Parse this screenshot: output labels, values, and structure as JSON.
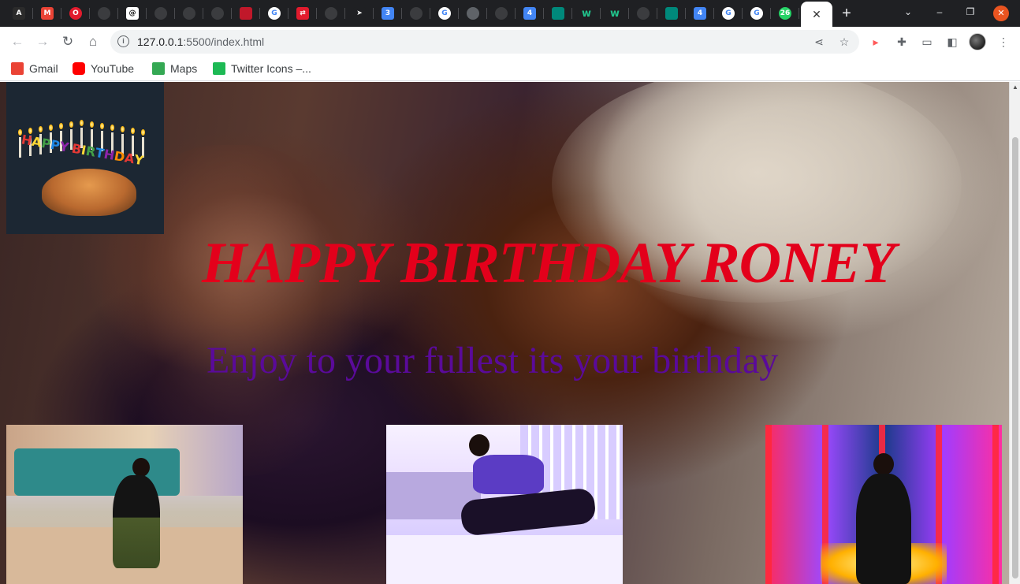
{
  "browser": {
    "tabs": [
      {
        "icon": "angular-icon",
        "color": "#2b2b2b",
        "glyph": "A"
      },
      {
        "icon": "gmail-icon",
        "color": "#ea4335",
        "glyph": "M"
      },
      {
        "icon": "opera-icon",
        "color": "#e21b2d",
        "glyph": "O"
      },
      {
        "icon": "github-icon",
        "color": "#3b3c3f",
        "glyph": ""
      },
      {
        "icon": "chatgpt-icon",
        "color": "#ffffff",
        "glyph": "@"
      },
      {
        "icon": "github-icon",
        "color": "#3b3c3f",
        "glyph": ""
      },
      {
        "icon": "github-icon",
        "color": "#3b3c3f",
        "glyph": ""
      },
      {
        "icon": "github-icon",
        "color": "#3b3c3f",
        "glyph": ""
      },
      {
        "icon": "ruby-icon",
        "color": "#c0182a",
        "glyph": ""
      },
      {
        "icon": "google-icon",
        "color": "#ffffff",
        "glyph": "G"
      },
      {
        "icon": "red-app-icon",
        "color": "#e21b2d",
        "glyph": "⇄"
      },
      {
        "icon": "globe-icon",
        "color": "#3b3c3f",
        "glyph": ""
      },
      {
        "icon": "arrow-icon",
        "color": "#1f2023",
        "glyph": "➤"
      },
      {
        "icon": "calendar-icon",
        "color": "#4285f4",
        "glyph": "3"
      },
      {
        "icon": "globe-icon",
        "color": "#3b3c3f",
        "glyph": ""
      },
      {
        "icon": "google-icon",
        "color": "#ffffff",
        "glyph": "G"
      },
      {
        "icon": "globe-icon",
        "color": "#5f6368",
        "glyph": ""
      },
      {
        "icon": "globe-icon",
        "color": "#3b3c3f",
        "glyph": ""
      },
      {
        "icon": "calendar-icon",
        "color": "#4285f4",
        "glyph": "4"
      },
      {
        "icon": "meet-icon",
        "color": "#00897b",
        "glyph": ""
      },
      {
        "icon": "w-icon",
        "color": "#1f2023",
        "glyph": "w"
      },
      {
        "icon": "w-icon",
        "color": "#1f2023",
        "glyph": "w"
      },
      {
        "icon": "globe-icon",
        "color": "#3b3c3f",
        "glyph": ""
      },
      {
        "icon": "meet-icon",
        "color": "#00897b",
        "glyph": ""
      },
      {
        "icon": "calendar-icon",
        "color": "#4285f4",
        "glyph": "4"
      },
      {
        "icon": "google-icon",
        "color": "#ffffff",
        "glyph": "G"
      },
      {
        "icon": "google-icon",
        "color": "#ffffff",
        "glyph": "G"
      },
      {
        "icon": "whatsapp-icon",
        "color": "#25d366",
        "glyph": "26"
      }
    ],
    "new_tab_glyph": "+",
    "url_host": "127.0.0.1",
    "url_path": ":5500/index.html",
    "bookmarks": [
      {
        "label": "Gmail",
        "icon": "gmail-icon",
        "color": "#ea4335"
      },
      {
        "label": "YouTube",
        "icon": "youtube-icon",
        "color": "#ff0000"
      },
      {
        "label": "Maps",
        "icon": "maps-icon",
        "color": "#34a853"
      },
      {
        "label": "Twitter Icons –...",
        "icon": "twitter-icons-icon",
        "color": "#1db954"
      }
    ]
  },
  "page": {
    "headline": "HAPPY BIRTHDAY RONEY",
    "subline": "Enjoy to your fullest its your birthday",
    "cake_text": "HAPPY BIRTHDAY",
    "headline_color": "#e3001b",
    "subline_color": "#5a0a9a"
  }
}
